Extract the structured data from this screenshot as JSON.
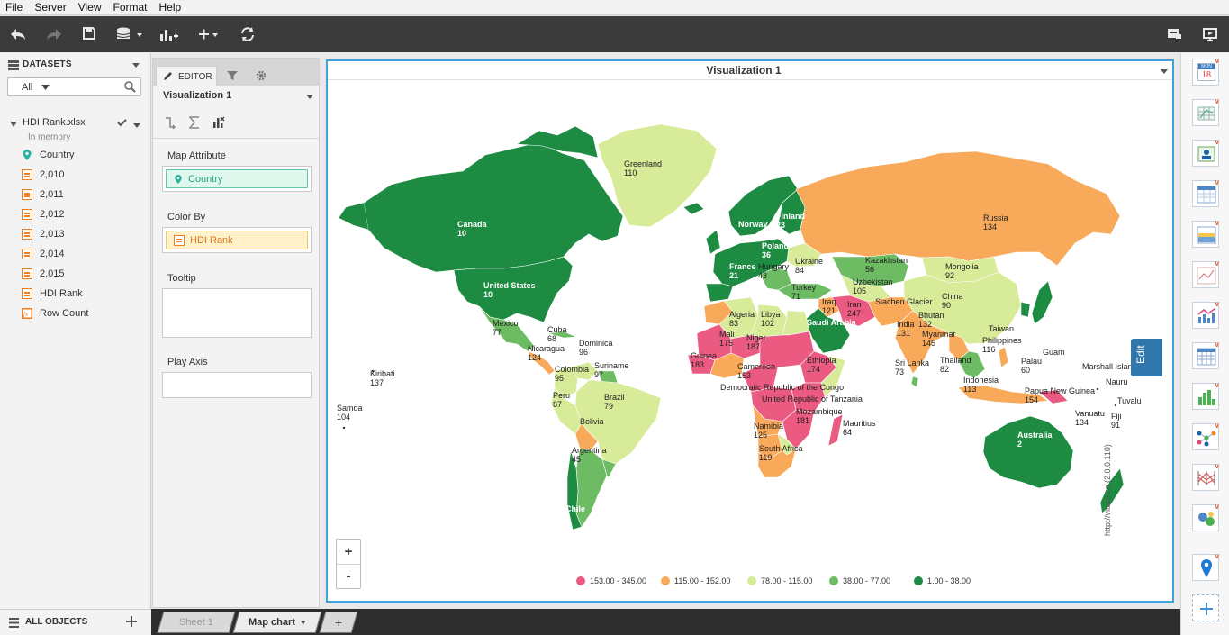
{
  "menu": [
    "File",
    "Server",
    "View",
    "Format",
    "Help"
  ],
  "datasets": {
    "title": "DATASETS",
    "filter_value": "All",
    "file_name": "HDI Rank.xlsx",
    "file_status": "In memory",
    "fields": [
      {
        "label": "Country",
        "icon": "location-pin-icon"
      },
      {
        "label": "2,010",
        "icon": "measure-icon"
      },
      {
        "label": "2,011",
        "icon": "measure-icon"
      },
      {
        "label": "2,012",
        "icon": "measure-icon"
      },
      {
        "label": "2,013",
        "icon": "measure-icon"
      },
      {
        "label": "2,014",
        "icon": "measure-icon"
      },
      {
        "label": "2,015",
        "icon": "measure-icon"
      },
      {
        "label": "HDI Rank",
        "icon": "measure-icon"
      },
      {
        "label": "Row Count",
        "icon": "formula-icon"
      }
    ],
    "all_objects": "ALL OBJECTS"
  },
  "editor": {
    "tab_label": "EDITOR",
    "viz_name": "Visualization 1",
    "map_attribute_label": "Map Attribute",
    "map_attribute_value": "Country",
    "color_by_label": "Color By",
    "color_by_value": "HDI Rank",
    "tooltip_label": "Tooltip",
    "play_axis_label": "Play Axis"
  },
  "viz": {
    "title": "Visualization 1",
    "edit_label": "Edit",
    "zoom_in": "+",
    "zoom_out": "-",
    "credit": "http://vitara.co (2.0.0.110)",
    "legend": [
      {
        "label": "153.00 - 345.00",
        "color": "#ea5a81"
      },
      {
        "label": "115.00 - 152.00",
        "color": "#f8a95a"
      },
      {
        "label": "78.00 - 115.00",
        "color": "#d7eb98"
      },
      {
        "label": "38.00 - 77.00",
        "color": "#6dbb63"
      },
      {
        "label": "1.00 - 38.00",
        "color": "#1e8b43"
      }
    ],
    "countries": [
      {
        "name": "Greenland",
        "value": "110",
        "white": false
      },
      {
        "name": "Canada",
        "value": "10",
        "white": true
      },
      {
        "name": "United States",
        "value": "10",
        "white": true
      },
      {
        "name": "Russia",
        "value": "134",
        "white": false
      },
      {
        "name": "Kazakhstan",
        "value": "56",
        "white": false
      },
      {
        "name": "Mongolia",
        "value": "92",
        "white": false
      },
      {
        "name": "China",
        "value": "90",
        "white": false
      },
      {
        "name": "Uzbekistan",
        "value": "105",
        "white": false
      },
      {
        "name": "Iran",
        "value": "247",
        "white": false
      },
      {
        "name": "India",
        "value": "131",
        "white": false
      },
      {
        "name": "Bhutan",
        "value": "132",
        "white": false
      },
      {
        "name": "Myanmar",
        "value": "145",
        "white": false
      },
      {
        "name": "Thailand",
        "value": "82",
        "white": false
      },
      {
        "name": "Sri Lanka",
        "value": "73",
        "white": false
      },
      {
        "name": "Taiwan",
        "value": "",
        "white": false
      },
      {
        "name": "Philippines",
        "value": "116",
        "white": false
      },
      {
        "name": "Guam",
        "value": "",
        "white": false
      },
      {
        "name": "Palau",
        "value": "60",
        "white": false
      },
      {
        "name": "Marshall Islands",
        "value": "",
        "white": false
      },
      {
        "name": "Nauru",
        "value": "",
        "white": false
      },
      {
        "name": "Tuvalu",
        "value": "",
        "white": false
      },
      {
        "name": "Vanuatu",
        "value": "134",
        "white": false
      },
      {
        "name": "Fiji",
        "value": "91",
        "white": false
      },
      {
        "name": "Indonesia",
        "value": "113",
        "white": false
      },
      {
        "name": "Papua New Guinea",
        "value": "154",
        "white": false
      },
      {
        "name": "Australia",
        "value": "2",
        "white": true
      },
      {
        "name": "Mauritius",
        "value": "64",
        "white": false
      },
      {
        "name": "Mexico",
        "value": "77",
        "white": false
      },
      {
        "name": "Cuba",
        "value": "68",
        "white": false
      },
      {
        "name": "Dominica",
        "value": "96",
        "white": false
      },
      {
        "name": "Nicaragua",
        "value": "124",
        "white": false
      },
      {
        "name": "Colombia",
        "value": "95",
        "white": false
      },
      {
        "name": "Suriname",
        "value": "97",
        "white": false
      },
      {
        "name": "Peru",
        "value": "87",
        "white": false
      },
      {
        "name": "Brazil",
        "value": "79",
        "white": false
      },
      {
        "name": "Bolivia",
        "value": "",
        "white": false
      },
      {
        "name": "Argentina",
        "value": "45",
        "white": false
      },
      {
        "name": "Chile",
        "value": "",
        "white": true
      },
      {
        "name": "Kiribati",
        "value": "137",
        "white": false
      },
      {
        "name": "Samoa",
        "value": "104",
        "white": false
      },
      {
        "name": "Algeria",
        "value": "83",
        "white": false
      },
      {
        "name": "Libya",
        "value": "102",
        "white": false
      },
      {
        "name": "Mali",
        "value": "175",
        "white": false
      },
      {
        "name": "Niger",
        "value": "187",
        "white": false
      },
      {
        "name": "Guinea",
        "value": "183",
        "white": false
      },
      {
        "name": "Cameroon",
        "value": "153",
        "white": false
      },
      {
        "name": "Ethiopia",
        "value": "174",
        "white": false
      },
      {
        "name": "Democratic Republic of the Congo",
        "value": "",
        "white": false
      },
      {
        "name": "United Republic of Tanzania",
        "value": "",
        "white": false
      },
      {
        "name": "Mozambique",
        "value": "181",
        "white": false
      },
      {
        "name": "Namibia",
        "value": "125",
        "white": false
      },
      {
        "name": "South Africa",
        "value": "119",
        "white": false
      },
      {
        "name": "Iraq",
        "value": "121",
        "white": false
      },
      {
        "name": "Saudi Arabia",
        "value": "",
        "white": true
      },
      {
        "name": "Siachen Glacier",
        "value": "",
        "white": false
      },
      {
        "name": "Ukraine",
        "value": "84",
        "white": false
      },
      {
        "name": "Turkey",
        "value": "71",
        "white": false
      },
      {
        "name": "Hungary",
        "value": "43",
        "white": false
      },
      {
        "name": "France",
        "value": "21",
        "white": true
      },
      {
        "name": "Finland",
        "value": "23",
        "white": true
      },
      {
        "name": "Norway",
        "value": "",
        "white": true
      },
      {
        "name": "Poland",
        "value": "36",
        "white": true
      }
    ]
  },
  "sheets": {
    "sheet1": "Sheet 1",
    "sheet2": "Map chart",
    "add": "+"
  },
  "calendar_icon": {
    "month": "MON",
    "day": "18"
  }
}
